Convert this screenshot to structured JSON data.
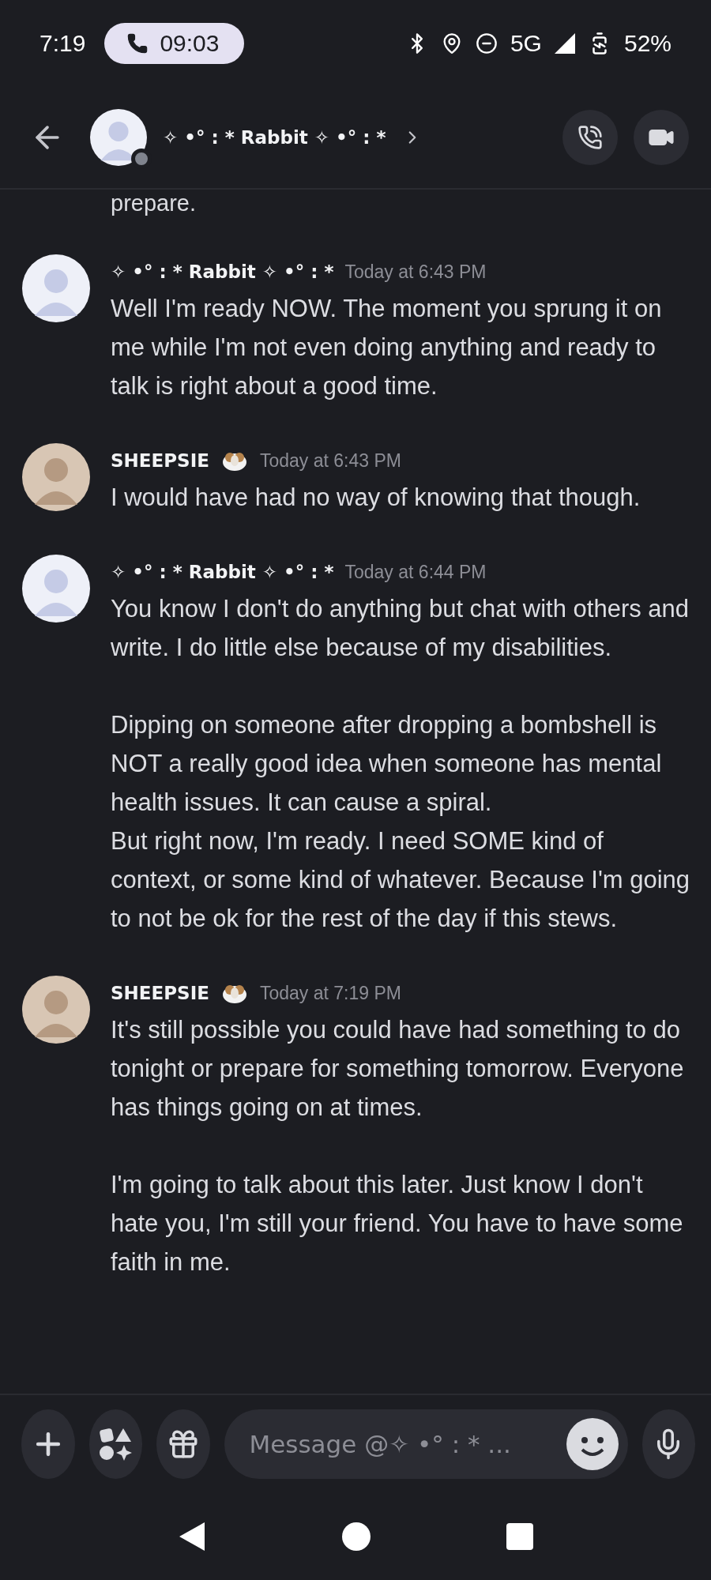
{
  "status_bar": {
    "time": "7:19",
    "call_timer": "09:03",
    "network": "5G",
    "battery": "52%"
  },
  "header": {
    "name": "✧ •° : * Rabbit ✧ •° : *"
  },
  "partial_line": "prepare.",
  "messages": [
    {
      "author": "✧ •° : * Rabbit ✧ •° : *",
      "badge": false,
      "timestamp": "Today at 6:43 PM",
      "paragraphs": [
        "Well I'm ready NOW. The moment you sprung it on me while I'm not even doing anything and ready to talk is right about a good time."
      ]
    },
    {
      "author": "SHEEPSIE",
      "badge": true,
      "timestamp": "Today at 6:43 PM",
      "paragraphs": [
        "I would have had no way of knowing that though."
      ]
    },
    {
      "author": "✧ •° : * Rabbit ✧ •° : *",
      "badge": false,
      "timestamp": "Today at 6:44 PM",
      "paragraphs": [
        "You know I don't do anything but chat with others and write. I do little else because of my disabilities.",
        "Dipping on someone after dropping a bombshell is NOT a really good idea when someone has mental health issues. It can cause a spiral.\nBut right now, I'm ready. I need SOME kind of context, or some kind of whatever. Because I'm going to not be ok for the rest of the day if this stews."
      ]
    },
    {
      "author": "SHEEPSIE",
      "badge": true,
      "timestamp": "Today at 7:19 PM",
      "paragraphs": [
        "It's still possible you could have had something to do tonight or prepare for something tomorrow. Everyone has things going on at times.",
        "I'm going to talk about this later. Just know I don't hate you, I'm still your friend. You have to have some faith in me."
      ]
    }
  ],
  "composer": {
    "placeholder": "Message @✧ •° : * ..."
  }
}
